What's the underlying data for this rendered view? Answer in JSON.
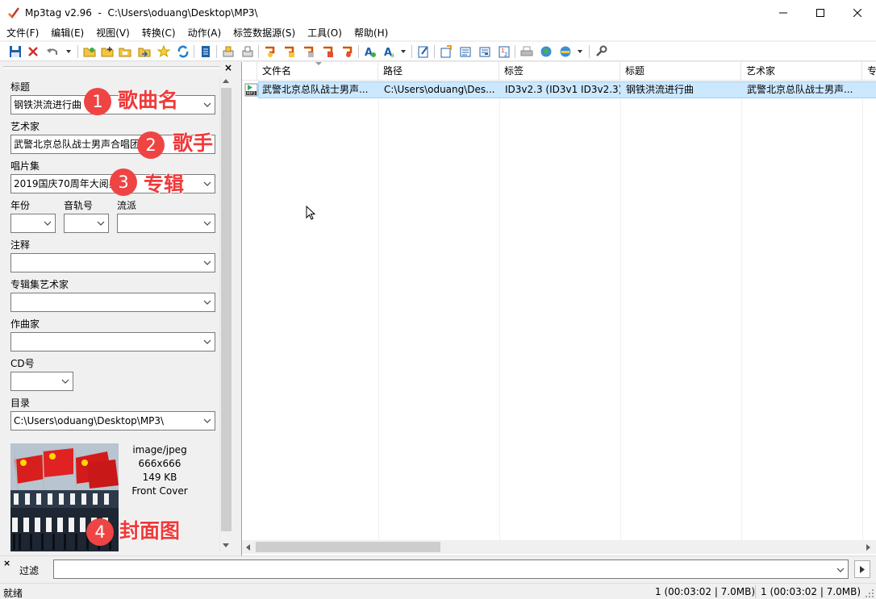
{
  "window": {
    "title": "Mp3tag v2.96  -  C:\\Users\\oduang\\Desktop\\MP3\\",
    "controls": [
      "minimize",
      "maximize",
      "close"
    ]
  },
  "menu": {
    "items": [
      "文件(F)",
      "编辑(E)",
      "视图(V)",
      "转换(C)",
      "动作(A)",
      "标签数据源(S)",
      "工具(O)",
      "帮助(H)"
    ]
  },
  "toolbar": {
    "icons": [
      "save-icon",
      "remove-tag-icon",
      "undo-icon",
      "change-dir-icon",
      "add-dir-icon",
      "save-playlist-icon",
      "export-icon",
      "favorites-icon",
      "refresh-icon",
      "extended-tags-icon",
      "copy-tag-icon",
      "paste-tag-icon",
      "tag-filename-icon",
      "filename-tag-icon",
      "text-tag-icon",
      "tag-tag-icon",
      "filename-filename-icon",
      "actions-icon",
      "actions-quick-icon",
      "edit-icon",
      "import-icon",
      "tag-source-icon",
      "tag-source-2-icon",
      "autonumber-icon",
      "print-icon",
      "web-icon",
      "web-sources-icon",
      "settings-icon"
    ]
  },
  "fields": {
    "title": {
      "label": "标题",
      "value": "钢铁洪流进行曲"
    },
    "artist": {
      "label": "艺术家",
      "value": "武警北京总队战士男声合唱团"
    },
    "album": {
      "label": "唱片集",
      "value": "2019国庆70周年大阅兵"
    },
    "year": {
      "label": "年份",
      "value": ""
    },
    "track": {
      "label": "音轨号",
      "value": ""
    },
    "genre": {
      "label": "流派",
      "value": ""
    },
    "comment": {
      "label": "注释",
      "value": ""
    },
    "album_artist": {
      "label": "专辑集艺术家",
      "value": ""
    },
    "composer": {
      "label": "作曲家",
      "value": ""
    },
    "disc": {
      "label": "CD号",
      "value": ""
    },
    "directory": {
      "label": "目录",
      "value": "C:\\Users\\oduang\\Desktop\\MP3\\"
    }
  },
  "cover": {
    "mime": "image/jpeg",
    "dimensions": "666x666",
    "size": "149 KB",
    "type": "Front Cover"
  },
  "annotations": [
    {
      "num": "1",
      "text": "歌曲名"
    },
    {
      "num": "2",
      "text": "歌手"
    },
    {
      "num": "3",
      "text": "专辑"
    },
    {
      "num": "4",
      "text": "封面图"
    }
  ],
  "list": {
    "columns": [
      "文件名",
      "路径",
      "标签",
      "标题",
      "艺术家",
      "专"
    ],
    "rows": [
      {
        "filename": "武警北京总队战士男声...",
        "path": "C:\\Users\\oduang\\Des...",
        "tag": "ID3v2.3 (ID3v1 ID3v2.3)",
        "title": "钢铁洪流进行曲",
        "artist": "武警北京总队战士男声..."
      }
    ]
  },
  "filter": {
    "label": "过滤",
    "value": ""
  },
  "status": {
    "text": "就绪",
    "selected": "1 (00:03:02 | 7.0MB)",
    "total": "1 (00:03:02 | 7.0MB)"
  },
  "colors": {
    "selection": "#cce8ff",
    "annotation": "#ef4444"
  }
}
